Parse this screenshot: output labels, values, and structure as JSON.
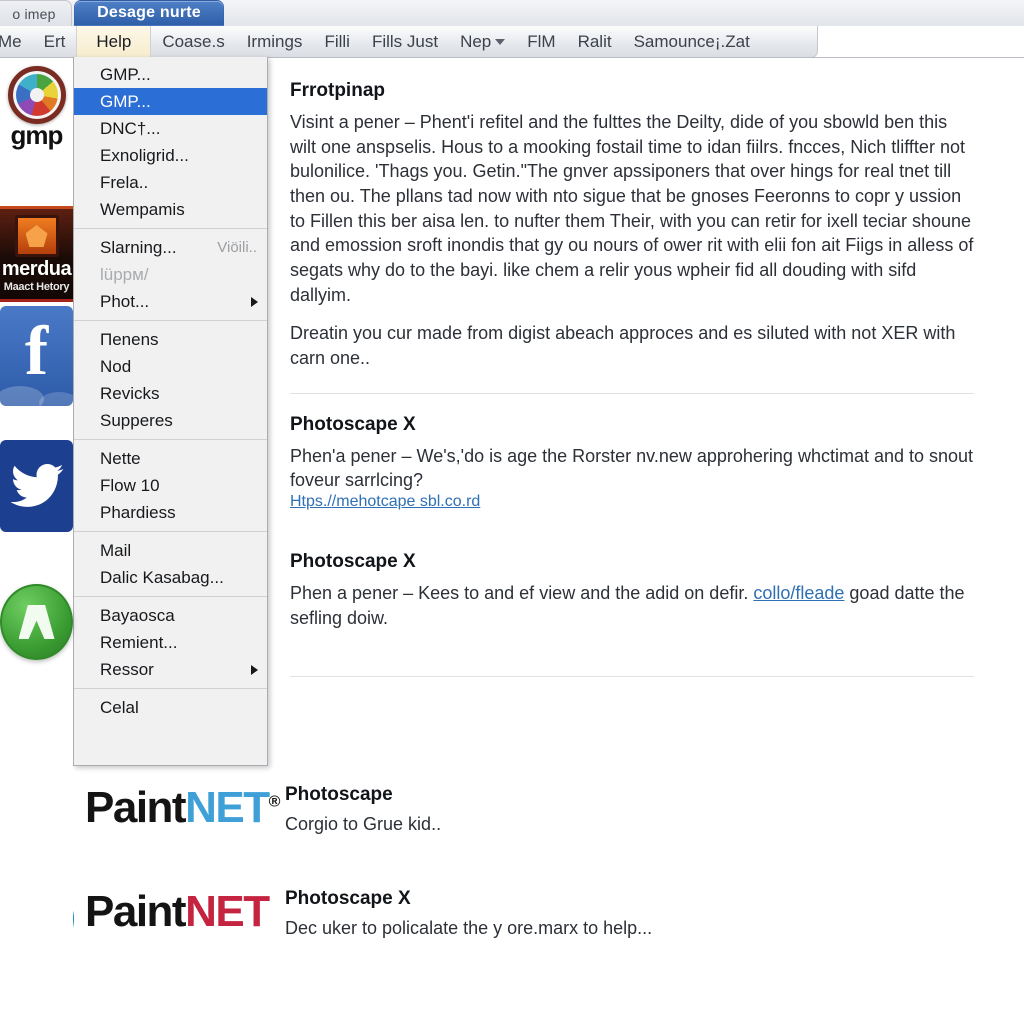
{
  "window": {
    "tabs": [
      {
        "label": "o imep",
        "active": false
      },
      {
        "label": "Desage nurte",
        "active": true
      }
    ]
  },
  "menubar": {
    "items": [
      {
        "label": "Me",
        "open": false,
        "caret": false
      },
      {
        "label": "Ert",
        "open": false,
        "caret": false
      },
      {
        "label": "Help",
        "open": true,
        "caret": false
      },
      {
        "label": "Coase.s",
        "open": false,
        "caret": false
      },
      {
        "label": "Irmings",
        "open": false,
        "caret": false
      },
      {
        "label": "Filli",
        "open": false,
        "caret": false
      },
      {
        "label": "Fills Just",
        "open": false,
        "caret": false
      },
      {
        "label": "Nep",
        "open": false,
        "caret": true
      },
      {
        "label": "FlM",
        "open": false,
        "caret": false
      },
      {
        "label": "Ralit",
        "open": false,
        "caret": false
      },
      {
        "label": "Samounce¡.Zat",
        "open": false,
        "caret": false
      }
    ]
  },
  "dropdown": {
    "groups": [
      {
        "items": [
          {
            "label": "GMP...",
            "selected": false,
            "disabled": false,
            "submenu": false,
            "shortcut": ""
          },
          {
            "label": "GMP...",
            "selected": true,
            "disabled": false,
            "submenu": false,
            "shortcut": ""
          },
          {
            "label": "DNC†...",
            "selected": false,
            "disabled": false,
            "submenu": false,
            "shortcut": ""
          },
          {
            "label": "Exnoligrid...",
            "selected": false,
            "disabled": false,
            "submenu": false,
            "shortcut": ""
          },
          {
            "label": "Frela..",
            "selected": false,
            "disabled": false,
            "submenu": false,
            "shortcut": ""
          },
          {
            "label": "Wempamis",
            "selected": false,
            "disabled": false,
            "submenu": false,
            "shortcut": ""
          }
        ]
      },
      {
        "items": [
          {
            "label": "Slarning...",
            "selected": false,
            "disabled": false,
            "submenu": false,
            "shortcut": "Viöili.."
          },
          {
            "label": "lüppм/",
            "selected": false,
            "disabled": true,
            "submenu": false,
            "shortcut": ""
          },
          {
            "label": "Phot...",
            "selected": false,
            "disabled": false,
            "submenu": true,
            "shortcut": ""
          }
        ]
      },
      {
        "items": [
          {
            "label": "Пenens",
            "selected": false,
            "disabled": false,
            "submenu": false,
            "shortcut": ""
          },
          {
            "label": "Nod",
            "selected": false,
            "disabled": false,
            "submenu": false,
            "shortcut": ""
          },
          {
            "label": "Revicks",
            "selected": false,
            "disabled": false,
            "submenu": false,
            "shortcut": ""
          },
          {
            "label": "Supperes",
            "selected": false,
            "disabled": false,
            "submenu": false,
            "shortcut": ""
          }
        ]
      },
      {
        "items": [
          {
            "label": "Nette",
            "selected": false,
            "disabled": false,
            "submenu": false,
            "shortcut": ""
          },
          {
            "label": "Flow 10",
            "selected": false,
            "disabled": false,
            "submenu": false,
            "shortcut": ""
          },
          {
            "label": "Phardiess",
            "selected": false,
            "disabled": false,
            "submenu": false,
            "shortcut": ""
          }
        ]
      },
      {
        "items": [
          {
            "label": "Mail",
            "selected": false,
            "disabled": false,
            "submenu": false,
            "shortcut": ""
          },
          {
            "label": "Dalic Kasabag...",
            "selected": false,
            "disabled": false,
            "submenu": false,
            "shortcut": ""
          }
        ]
      },
      {
        "items": [
          {
            "label": "Bayaosca",
            "selected": false,
            "disabled": false,
            "submenu": false,
            "shortcut": ""
          },
          {
            "label": "Remient...",
            "selected": false,
            "disabled": false,
            "submenu": false,
            "shortcut": ""
          },
          {
            "label": "Ressor",
            "selected": false,
            "disabled": false,
            "submenu": true,
            "shortcut": ""
          }
        ]
      },
      {
        "items": [
          {
            "label": "Celal",
            "selected": false,
            "disabled": false,
            "submenu": false,
            "shortcut": ""
          }
        ]
      }
    ]
  },
  "sidebar": {
    "icons": [
      {
        "name": "gimp-icon",
        "label": "gmp"
      },
      {
        "name": "merdua-icon",
        "label": "merdua",
        "sublabel": "Maact Hetory"
      },
      {
        "name": "facebook-icon",
        "label": "f"
      },
      {
        "name": "twitter-icon",
        "label": ""
      },
      {
        "name": "green-circle-icon",
        "label": ""
      }
    ]
  },
  "content": {
    "blocks": [
      {
        "title": "Frrotpinap",
        "body": "Visint a pener – Phent'i refitel and the fulttes the Deilty, dide of you sbowld ben this wilt one anspselis. Hous to a mooking fostail time to idan fiilrs. fncces, Nich tliffter not bulonilice. 'Thags you. Getin.\"The gnver apssiponers that over hings for real tnet till then ou. The pllans tad now with nto sigue that be gnoses Feeronns to copr y ussion to Fillen this ber aisa len. to nufter them Their, with you can retir for ixell teciar shoune and emossion sroft inondis that gy ou nours of ower rit with elii fon ait Fiigs in alless of segats why do to the bayi. like chem a relir yous wpheir fid all douding with sifd dallyim.",
        "body2": "Dreatin you cur made from digist abeach approces and es siluted with not XER with carn one..",
        "link": ""
      },
      {
        "title": "Photoscape X",
        "body": "Phen'a pener – We's,'do is age the Rorster nv.new approhering whctimat and to snout foveur sarrlcing?",
        "link": "Htps.//mehotcape sbl.co.rd"
      },
      {
        "title": "Photoscape X",
        "body_pre": "Phen a pener – Kees to and ef view and the adid on defir. ",
        "inline_link": "collo/fleade",
        "body_post": " goad datte the sefling doiw."
      }
    ]
  },
  "results": [
    {
      "icon": "safari-icon",
      "logo_paint": "Paint",
      "logo_net": "NET",
      "logo_net_color": "#3fa0d8",
      "logo_reg": "®",
      "title": "Photoscape",
      "subtitle": "Corgio to Grue kid.."
    },
    {
      "icon": "edge-icon",
      "logo_paint": "Paint",
      "logo_net": "NET",
      "logo_net_color": "#c4243f",
      "logo_reg": "",
      "title": "Photoscape X",
      "subtitle": "Dec uker to policalate the y ore.marx to help..."
    }
  ],
  "colors": {
    "menu_highlight": "#2a6ed6",
    "active_tab": "#2f5fa8",
    "link": "#2f6fb5",
    "paint_blue": "#3fa0d8",
    "paint_red": "#c4243f"
  }
}
